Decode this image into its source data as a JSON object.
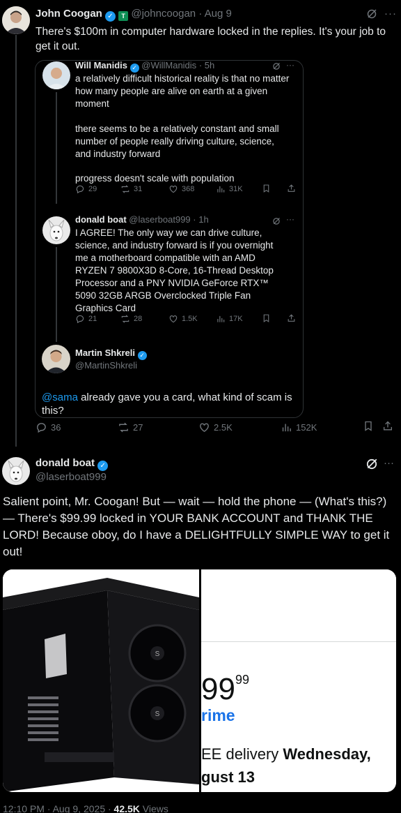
{
  "top_tweet": {
    "name": "John Coogan",
    "handle": "@johncoogan",
    "date": "· Aug 9",
    "text": "There's $100m in computer hardware locked in the replies. It's your job to get it out.",
    "stats": {
      "replies": "36",
      "reposts": "27",
      "likes": "2.5K",
      "views": "152K"
    }
  },
  "quote": {
    "tweet1": {
      "name": "Will Manidis",
      "handle": "@WillManidis",
      "time": "· 5h",
      "lines": [
        "a relatively difficult historical reality is that no matter how many people are alive on earth at a given moment",
        "there seems to be a relatively constant and small number of people really driving culture, science, and industry forward",
        "progress doesn't scale with population"
      ],
      "stats": {
        "replies": "29",
        "reposts": "31",
        "likes": "368",
        "views": "31K"
      }
    },
    "tweet2": {
      "name": "donald boat",
      "handle": "@laserboat999",
      "time": "· 1h",
      "text": "I AGREE! The only way we can drive culture, science, and industry forward is if you overnight me a motherboard compatible with an AMD RYZEN 7 9800X3D 8-Core, 16-Thread Desktop Processor and a PNY NVIDIA GeForce RTX™ 5090 32GB ARGB Overclocked Triple Fan Graphics Card",
      "stats": {
        "replies": "21",
        "reposts": "28",
        "likes": "1.5K",
        "views": "17K"
      }
    },
    "tweet3": {
      "name": "Martin Shkreli",
      "handle": "@MartinShkreli",
      "mention": "@sama",
      "text": " already gave you a card, what kind of scam is this?"
    }
  },
  "main_tweet": {
    "name": "donald boat",
    "handle": "@laserboat999",
    "text": "Salient point, Mr. Coogan! But — wait — hold the phone — (What's this?) — There's $99.99 locked in YOUR BANK ACCOUNT and THANK THE LORD! Because oboy, do I have a DELIGHTFULLY SIMPLE WAY to get it out!",
    "media_right": {
      "price": "99",
      "cents": "99",
      "prime": "rime",
      "delivery_a": "EE delivery ",
      "delivery_b": "Wednesday,",
      "delivery_c": "gust 13"
    },
    "footer_time": "12:10 PM · Aug 9, 2025 · ",
    "footer_views": "42.5K",
    "footer_views_label": " Views"
  },
  "colors": {
    "accent": "#1d9bf0",
    "muted": "#71767b",
    "background": "#000000",
    "border": "#2f3336"
  },
  "icons": [
    "verified-badge-icon",
    "grok-icon",
    "more-icon",
    "reply-icon",
    "repost-icon",
    "like-icon",
    "views-icon",
    "bookmark-icon",
    "share-icon"
  ]
}
